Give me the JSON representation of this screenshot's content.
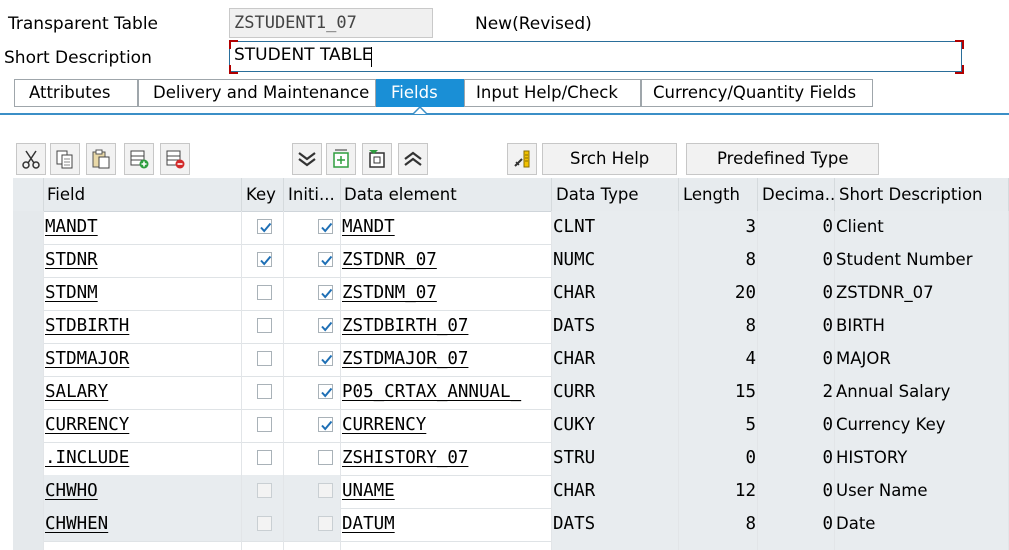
{
  "header": {
    "table_type_label": "Transparent Table",
    "table_name": "ZSTUDENT1_07",
    "status": "New(Revised)",
    "short_desc_label": "Short Description",
    "short_desc_value": "STUDENT TABLE"
  },
  "tabs": [
    {
      "label": "Attributes"
    },
    {
      "label": "Delivery and Maintenance"
    },
    {
      "label": "Fields"
    },
    {
      "label": "Input Help/Check"
    },
    {
      "label": "Currency/Quantity Fields"
    }
  ],
  "toolbar": {
    "icons": [
      "cut-icon",
      "copy-icon",
      "paste-icon",
      "insert-row-icon",
      "delete-row-icon",
      "collapse-icon",
      "expand-icon",
      "select-icon",
      "deselect-icon",
      "key-help-icon"
    ],
    "srch_help_label": "Srch Help",
    "predefined_type_label": "Predefined Type"
  },
  "columns": [
    "Field",
    "Key",
    "Initi...",
    "Data element",
    "Data Type",
    "Length",
    "Decima...",
    "Short Description"
  ],
  "rows": [
    {
      "field": "MANDT",
      "key": true,
      "init": true,
      "data_element": "MANDT",
      "data_type": "CLNT",
      "length": "3",
      "decimals": "0",
      "description": "Client"
    },
    {
      "field": "STDNR",
      "key": true,
      "init": true,
      "data_element": "ZSTDNR_07",
      "data_type": "NUMC",
      "length": "8",
      "decimals": "0",
      "description": "Student Number"
    },
    {
      "field": "STDNM",
      "key": false,
      "init": true,
      "data_element": "ZSTDNM_07",
      "data_type": "CHAR",
      "length": "20",
      "decimals": "0",
      "description": "ZSTDNR_07"
    },
    {
      "field": "STDBIRTH",
      "key": false,
      "init": true,
      "data_element": "ZSTDBIRTH_07",
      "data_type": "DATS",
      "length": "8",
      "decimals": "0",
      "description": "BIRTH"
    },
    {
      "field": "STDMAJOR",
      "key": false,
      "init": true,
      "data_element": "ZSTDMAJOR_07",
      "data_type": "CHAR",
      "length": "4",
      "decimals": "0",
      "description": "MAJOR"
    },
    {
      "field": "SALARY",
      "key": false,
      "init": true,
      "data_element": "P05_CRTAX_ANNUAL_",
      "data_type": "CURR",
      "length": "15",
      "decimals": "2",
      "description": "Annual Salary"
    },
    {
      "field": "CURRENCY",
      "key": false,
      "init": true,
      "data_element": "CURRENCY",
      "data_type": "CUKY",
      "length": "5",
      "decimals": "0",
      "description": "Currency Key"
    },
    {
      "field": ".INCLUDE",
      "key": false,
      "init": false,
      "data_element": "ZSHISTORY_07",
      "data_type": "STRU",
      "length": "0",
      "decimals": "0",
      "description": "HISTORY"
    },
    {
      "field": "CHWHO",
      "key": false,
      "init": false,
      "data_element": "UNAME",
      "data_type": "CHAR",
      "length": "12",
      "decimals": "0",
      "description": "User Name",
      "included": true
    },
    {
      "field": "CHWHEN",
      "key": false,
      "init": false,
      "data_element": "DATUM",
      "data_type": "DATS",
      "length": "8",
      "decimals": "0",
      "description": "Date",
      "included": true
    }
  ],
  "colors": {
    "accent": "#1a8fd6",
    "check": "#1e6fb5"
  }
}
